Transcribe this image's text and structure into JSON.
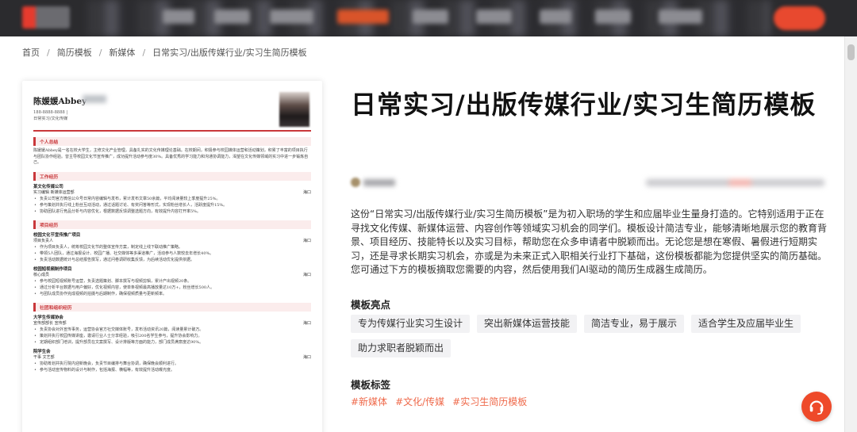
{
  "breadcrumb": [
    {
      "label": "首页"
    },
    {
      "label": "简历模板"
    },
    {
      "label": "新媒体"
    },
    {
      "label": "日常实习/出版传媒行业/实习生简历模板"
    }
  ],
  "resume_preview": {
    "name": "陈媛媛Abbey",
    "phone": "188-8888-8888 |",
    "intent": "日常实习/文化传媒",
    "sections": {
      "summary": "个人总结",
      "work": "工作经历",
      "projects": "项目经历",
      "activities": "社团和组织经历"
    },
    "summary_text": "陈媛媛Abbey是一名在校大学生，主修文化产业管理，具备扎实的文化传媒理论基础。在校期间，积极参与校园媒体运营和活动策划，积累了丰富的项目执行与团队协作经验。曾主导校园文化节宣传推广，成功提升活动参与度30%。具备优秀的学习能力和沟通协调能力，渴望在文化传媒领域的实习中进一步锻炼自己。",
    "work": {
      "org": "某文化传媒公司",
      "role": "实习编辑 新媒体运营部",
      "location": "海口",
      "bullets": [
        "负责公司官方微信公众号日常内容编辑与发布，累计发布文章50余篇，平均阅读量较上季度提升25%。",
        "参与策划并执行线上粉丝互动活动，通过话题讨论、有奖问答等形式，实现粉丝增长人，活跃度提升15%。",
        "协助团队进行竞品分析与内容优化，根据数据反馈调整选题方向，有效提升内容打开率5%。"
      ]
    },
    "projects": [
      {
        "org": "校园文化节宣传推广项目",
        "role": "项目负责人",
        "location": "海口",
        "bullets": [
          "作为项目负责人，统筹校园文化节的整体宣传方案，制定线上线下联动推广策略。",
          "带领5人团队，通过海报设计、校园广播、社交媒体等多渠道推广，活动参与人数较去年增长40%。",
          "负责活动数据统计与总结报告撰写，通过问卷调研收集反馈，为后续活动优化提供依据。"
        ]
      },
      {
        "org": "校园短视频制作项目",
        "role": "核心成员",
        "location": "海口",
        "bullets": [
          "参与校园短视频账号运营，负责选题策划、脚本撰写与视频剪辑，累计产出视频20条。",
          "通过分析平台数据与用户偏好，优化视频内容，使单条视频最高播放量达10万+，粉丝增长500人。",
          "与团队成员协作完成视频的拍摄与后期制作，确保视频质量与更新频率。"
        ]
      }
    ],
    "activities": [
      {
        "org": "大学生传媒协会",
        "role": "宣传部部长 宣传部",
        "location": "海口",
        "bullets": [
          "负责协会对外宣传事务，运营协会官方社交媒体账号，发布活动资讯20篇，阅读量累计破万。",
          "策划并执行校园传媒讲座，邀请行业人士分享经验，吸引200名学生参与，提升协会影响力。",
          "定期组织部门培训，提升部员在文案撰写、设计排版等方面的能力，部门成员满意度达90%。"
        ]
      },
      {
        "org": "院学生会",
        "role": "干事 文艺部",
        "location": "海口",
        "bullets": [
          "协助筹划并执行院内迎新晚会，负责节目编排与舞台协调，确保晚会顺利进行。",
          "参与活动宣传物料的设计与制作，包括海报、横幅等，有效提升活动曝光度。"
        ]
      }
    ]
  },
  "title": "日常实习/出版传媒行业/实习生简历模板",
  "description": "这份“日常实习/出版传媒行业/实习生简历模板”是为初入职场的学生和应届毕业生量身打造的。它特别适用于正在寻找文化传媒、新媒体运营、内容创作等领域实习机会的同学们。模板设计简洁专业，能够清晰地展示您的教育背景、项目经历、技能特长以及实习目标，帮助您在众多申请者中脱颖而出。无论您是想在寒假、暑假进行短期实习，还是寻求长期实习机会，亦或是为未来正式入职相关行业打下基础，这份模板都能为您提供坚实的简历基础。您可通过下方的模板摘取您需要的内容，然后使用我们AI驱动的简历生成器生成简历。",
  "highlights": {
    "heading": "模板亮点",
    "items": [
      "专为传媒行业实习生设计",
      "突出新媒体运营技能",
      "简洁专业，易于展示",
      "适合学生及应届毕业生",
      "助力求职者脱颖而出"
    ]
  },
  "tags": {
    "heading": "模板标签",
    "items": [
      "#新媒体",
      "#文化/传媒",
      "#实习生简历模板"
    ]
  },
  "colors": {
    "accent": "#ef6a4b",
    "resume_red": "#c9383b",
    "support_button": "#ee4a2a"
  },
  "icons": {
    "support": "headset-icon"
  }
}
